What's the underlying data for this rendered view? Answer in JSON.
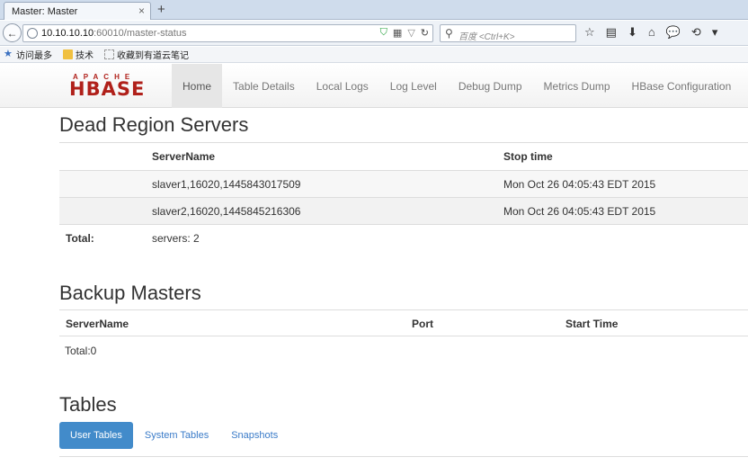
{
  "browser": {
    "tab_title": "Master: Master",
    "tab_close": "×",
    "new_tab": "+",
    "url_host": "10.10.10.10",
    "url_path": ":60010/master-status",
    "search_placeholder": "百度 <Ctrl+K>",
    "bookmarks": [
      {
        "label": "访问最多",
        "icon": "star-icon"
      },
      {
        "label": "技术",
        "icon": "folder-icon"
      },
      {
        "label": "收藏到有道云笔记",
        "icon": "page-icon"
      }
    ],
    "toolbar_glyphs": [
      "☆",
      "▤",
      "⬇",
      "⌂",
      "💬",
      "⟲",
      "▾"
    ]
  },
  "hbase": {
    "logo_top": "APACHE",
    "logo_main": "HBASE",
    "nav": [
      {
        "label": "Home",
        "active": true
      },
      {
        "label": "Table Details"
      },
      {
        "label": "Local Logs"
      },
      {
        "label": "Log Level"
      },
      {
        "label": "Debug Dump"
      },
      {
        "label": "Metrics Dump"
      },
      {
        "label": "HBase Configuration"
      }
    ]
  },
  "dead_servers": {
    "title": "Dead Region Servers",
    "headers": [
      "ServerName",
      "Stop time"
    ],
    "rows": [
      {
        "server": "slaver1,16020,1445843017509",
        "stop": "Mon Oct 26 04:05:43 EDT 2015"
      },
      {
        "server": "slaver2,16020,1445845216306",
        "stop": "Mon Oct 26 04:05:43 EDT 2015"
      }
    ],
    "total_label": "Total:",
    "total_value": "servers: 2"
  },
  "backup_masters": {
    "title": "Backup Masters",
    "headers": [
      "ServerName",
      "Port",
      "Start Time"
    ],
    "total": "Total:0"
  },
  "tables": {
    "title": "Tables",
    "tabs": [
      {
        "label": "User Tables",
        "active": true
      },
      {
        "label": "System Tables"
      },
      {
        "label": "Snapshots"
      }
    ]
  }
}
